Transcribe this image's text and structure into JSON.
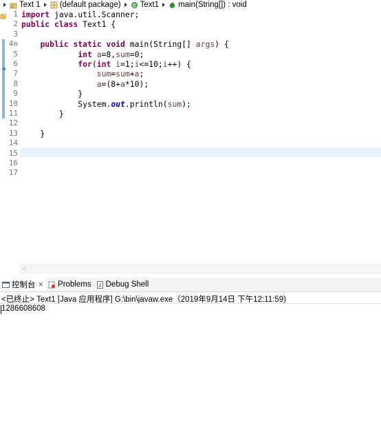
{
  "breadcrumb": {
    "project": "Text 1",
    "package": "(default package)",
    "class": "Text1",
    "method": "main(String[]) : void"
  },
  "editor": {
    "line_numbers": [
      "1",
      "2",
      "3",
      "4⊖",
      "5",
      "6",
      "7",
      "8",
      "9",
      "10",
      "11",
      "12",
      "13",
      "14",
      "15",
      "16",
      "17"
    ],
    "scroll_left_glyph": "<"
  },
  "console": {
    "tabs": {
      "console": "控制台",
      "problems": "Problems",
      "debug_shell": "Debug Shell"
    },
    "close_glyph": "✕",
    "status": "<已终止> Text1 [Java 应用程序] G:\\bin\\javaw.exe（2019年9月14日 下午12:11:59)",
    "output": "1286608608"
  },
  "colors": {
    "keyword": "#7f0055",
    "variable": "#6a3e3e",
    "field": "#0000c0",
    "current_line": "#e8f2fe"
  }
}
